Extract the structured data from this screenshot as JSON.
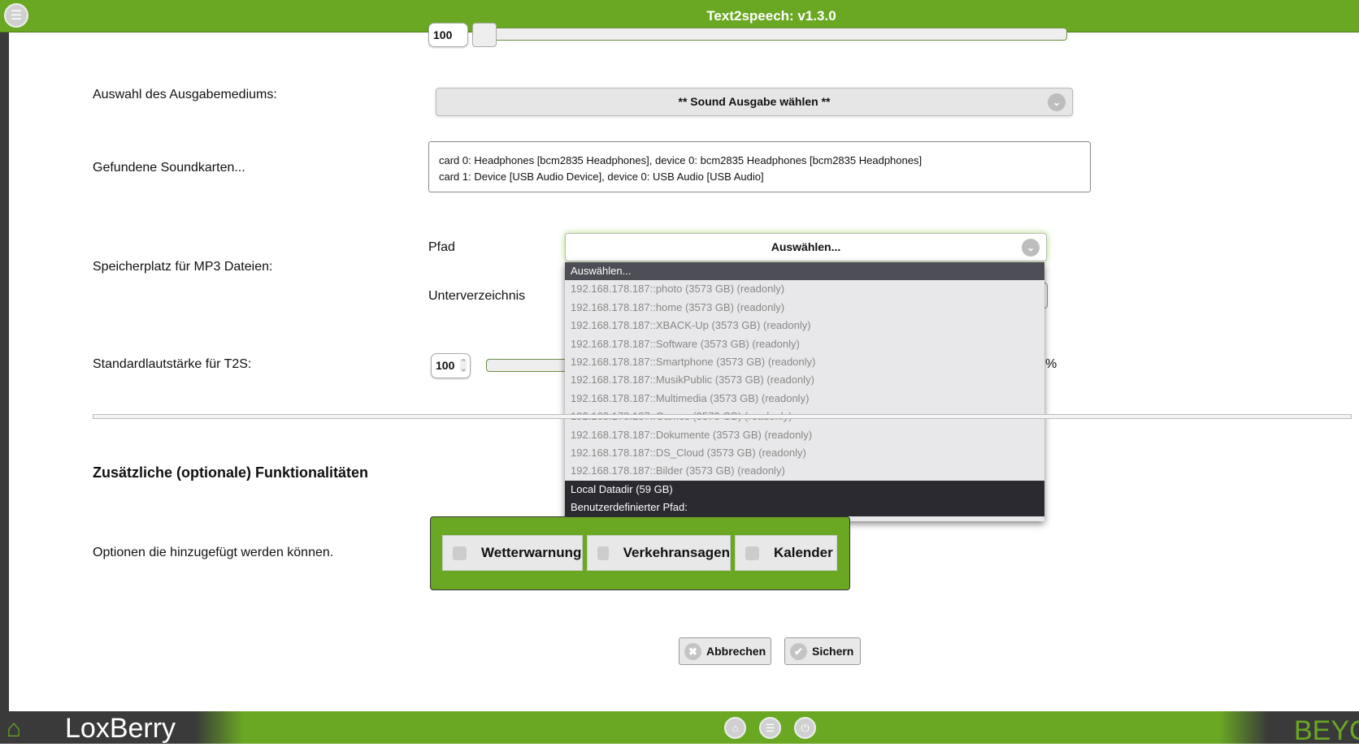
{
  "header": {
    "title": "Text2speech: v1.3.0"
  },
  "top_row": {
    "spinner_value": "100"
  },
  "output_medium": {
    "label": "Auswahl des Ausgabemediums:",
    "selected": "** Sound Ausgabe wählen **"
  },
  "soundcards": {
    "label": "Gefundene Soundkarten...",
    "lines": [
      "card 0: Headphones [bcm2835 Headphones], device 0: bcm2835 Headphones [bcm2835 Headphones]",
      "card 1: Device [USB Audio Device], device 0: USB Audio [USB Audio]"
    ]
  },
  "storage": {
    "label": "Speicherplatz für MP3 Dateien:",
    "path_label": "Pfad",
    "path_selected": "Auswählen...",
    "subdir_label": "Unterverzeichnis",
    "options": [
      "Auswählen...",
      "192.168.178.187::photo (3573 GB) (readonly)",
      "192.168.178.187::home (3573 GB) (readonly)",
      "192.168.178.187::XBACK-Up (3573 GB) (readonly)",
      "192.168.178.187::Software (3573 GB) (readonly)",
      "192.168.178.187::Smartphone (3573 GB) (readonly)",
      "192.168.178.187::MusikPublic (3573 GB) (readonly)",
      "192.168.178.187::Multimedia (3573 GB) (readonly)",
      "192.168.178.187::Games (3573 GB) (readonly)",
      "192.168.178.187::Dokumente (3573 GB) (readonly)",
      "192.168.178.187::DS_Cloud (3573 GB) (readonly)",
      "192.168.178.187::Bilder (3573 GB) (readonly)",
      "Local Datadir (59 GB)",
      "Benutzerdefinierter Pfad:"
    ]
  },
  "volume": {
    "label": "Standardlautstärke für T2S:",
    "value": "100",
    "unit": "%"
  },
  "optional": {
    "heading": "Zusätzliche (optionale) Funktionalitäten",
    "label": "Optionen die hinzugefügt werden können.",
    "items": [
      "Wetterwarnung",
      "Verkehransagen",
      "Kalender"
    ]
  },
  "buttons": {
    "cancel": "Abbrechen",
    "save": "Sichern"
  },
  "footer": {
    "logo": "LoxBerry",
    "right_text": "BEYOND"
  },
  "colors": {
    "brand_green": "#6aa823",
    "dark": "#3a3a3a"
  }
}
